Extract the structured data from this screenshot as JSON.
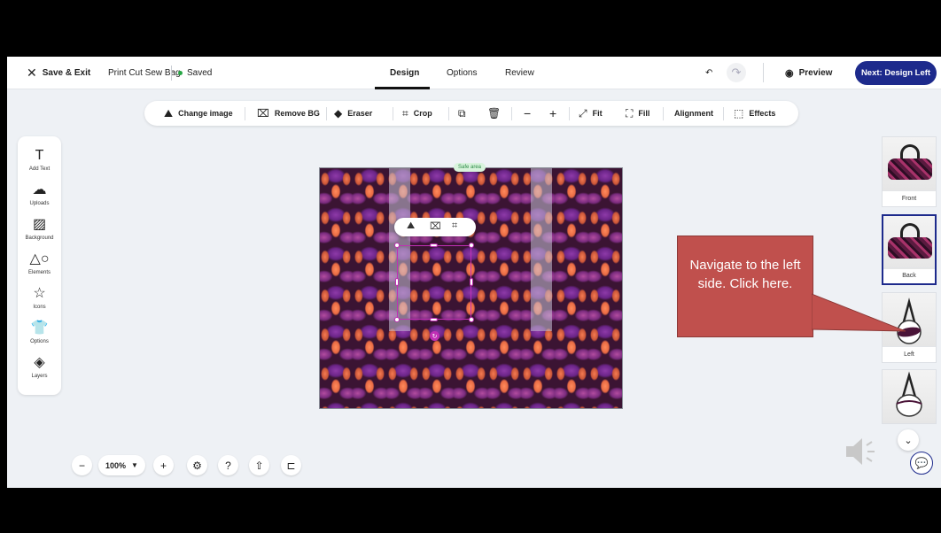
{
  "header": {
    "exit_label": "Save & Exit",
    "doc_name": "Print Cut Sew Bag",
    "status": "Saved",
    "tabs": [
      {
        "label": "Design",
        "active": true
      },
      {
        "label": "Options",
        "active": false
      },
      {
        "label": "Review",
        "active": false
      }
    ],
    "preview_label": "Preview",
    "next_label": "Next: Design Left"
  },
  "toolbar": {
    "change_image": "Change image",
    "remove_bg": "Remove BG",
    "eraser": "Eraser",
    "crop": "Crop",
    "fit": "Fit",
    "fill": "Fill",
    "alignment": "Alignment",
    "effects": "Effects"
  },
  "sidebar": {
    "items": [
      {
        "label": "Add Text",
        "icon": "text-icon"
      },
      {
        "label": "Uploads",
        "icon": "upload-icon"
      },
      {
        "label": "Background",
        "icon": "background-icon"
      },
      {
        "label": "Elements",
        "icon": "elements-icon"
      },
      {
        "label": "Icons",
        "icon": "star-icon"
      },
      {
        "label": "Options",
        "icon": "shirt-icon"
      },
      {
        "label": "Layers",
        "icon": "layers-icon"
      }
    ]
  },
  "canvas": {
    "safe_area_label": "Safe area"
  },
  "views": {
    "items": [
      {
        "label": "Front",
        "active": false
      },
      {
        "label": "Back",
        "active": true
      },
      {
        "label": "Left",
        "active": false
      },
      {
        "label": "",
        "active": false
      }
    ]
  },
  "callout": {
    "text": "Navigate to the left side. Click here."
  },
  "zoom": {
    "value": "100%"
  },
  "colors": {
    "accent": "#1d2a8c",
    "selection": "#c12fb5",
    "callout": "#c0504d",
    "saved_dot": "#27a745"
  }
}
